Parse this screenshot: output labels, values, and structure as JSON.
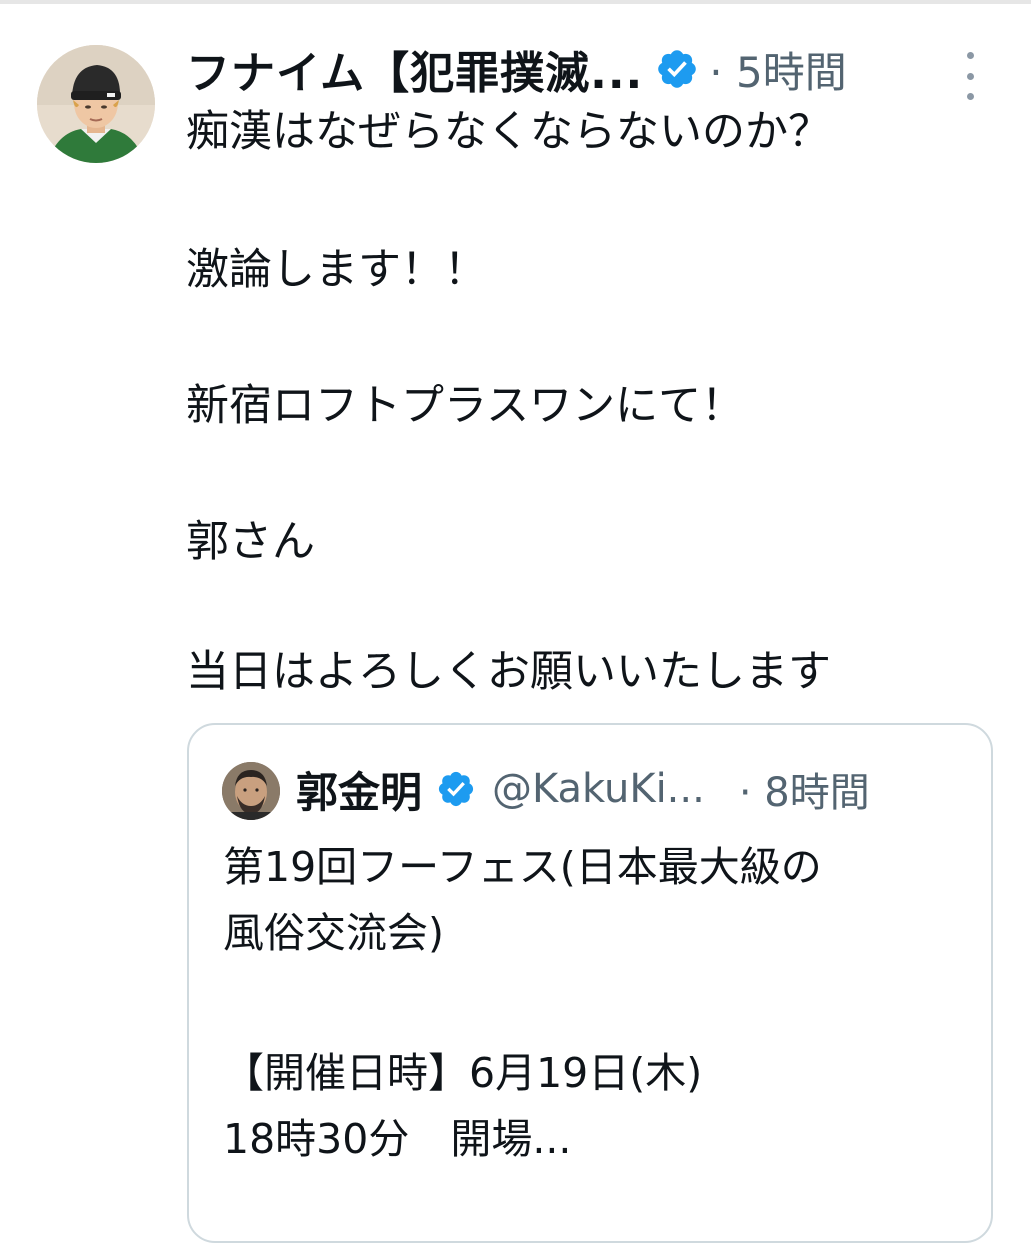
{
  "tweet": {
    "display_name": "フナイム【犯罪撲滅...",
    "timestamp": "· 5時間",
    "lines": [
      "痴漢はなぜらなくならないのか？",
      "激論します！！",
      "新宿ロフトプラスワンにて！",
      "郭さん",
      "当日はよろしくお願いいたします"
    ]
  },
  "quoted_tweet": {
    "display_name": "郭金明",
    "handle": "@KakuKi...",
    "timestamp": "· 8時間",
    "lines": [
      "第19回フーフェス(日本最大級の",
      "風俗交流会)",
      "【開催日時】6月19日(木)",
      "18時30分　開場..."
    ]
  },
  "icons": {
    "verified": "verified-badge-icon",
    "more": "more-options-icon"
  },
  "colors": {
    "verified_blue": "#1d9bf0",
    "secondary_text": "#536471",
    "primary_text": "#0f1419",
    "card_border": "#cfd9de"
  }
}
